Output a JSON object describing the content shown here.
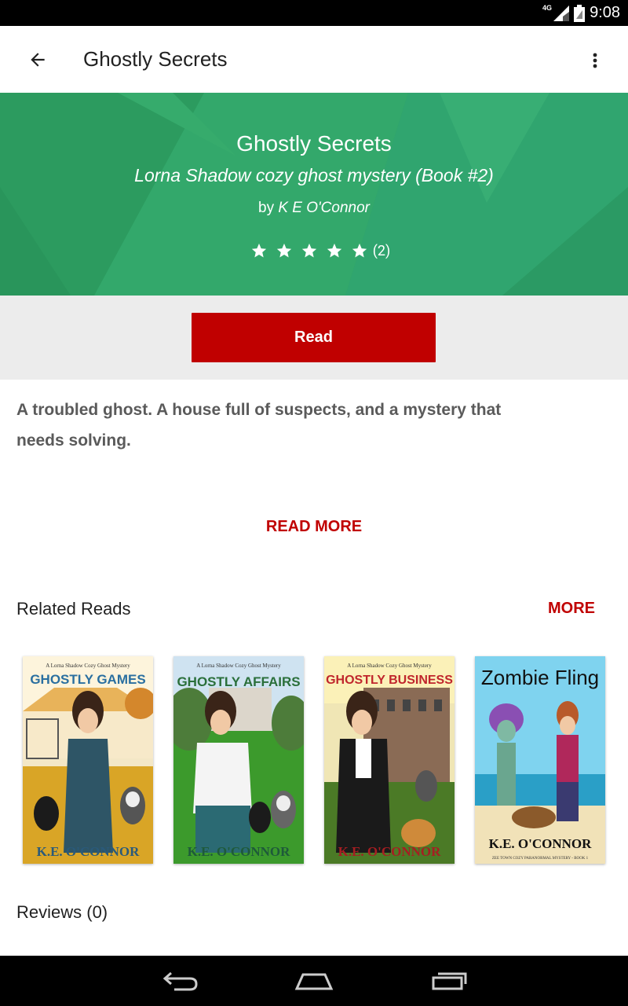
{
  "status_bar": {
    "network": "4G",
    "time": "9:08"
  },
  "app_bar": {
    "title": "Ghostly Secrets"
  },
  "hero": {
    "title": "Ghostly Secrets",
    "series": "Lorna Shadow cozy ghost mystery (Book #2)",
    "by": "by",
    "author": "K E O'Connor",
    "stars": 5,
    "rating_count": "(2)",
    "background_color": "#31a468"
  },
  "read_button": {
    "label": "Read",
    "color": "#c00000"
  },
  "description": {
    "text": "A troubled ghost. A house full of suspects, and a mystery that needs solving."
  },
  "read_more": {
    "label": "READ MORE"
  },
  "related": {
    "heading": "Related Reads",
    "more_label": "MORE",
    "covers": [
      {
        "series_line": "A Lorna Shadow Cozy Ghost Mystery",
        "title": "GHOSTLY GAMES",
        "author": "K.E. O'CONNOR"
      },
      {
        "series_line": "A Lorna Shadow Cozy Ghost Mystery",
        "title": "GHOSTLY AFFAIRS",
        "author": "K.E. O'CONNOR"
      },
      {
        "series_line": "A Lorna Shadow Cozy Ghost Mystery",
        "title": "GHOSTLY BUSINESS",
        "author": "K.E. O'CONNOR"
      },
      {
        "series_line": "",
        "title": "Zombie Fling",
        "author": "K.E. O'CONNOR",
        "footer": "ZEE TOWN COZY PARANORMAL MYSTERY - BOOK 1"
      }
    ]
  },
  "reviews": {
    "heading": "Reviews (0)"
  }
}
